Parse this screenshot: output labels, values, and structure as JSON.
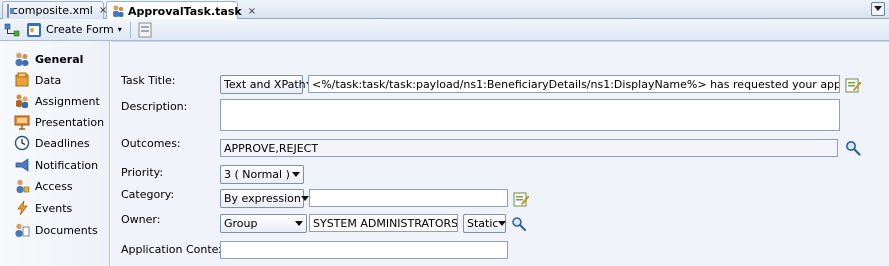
{
  "tabs": [
    {
      "label": "composite.xml",
      "close": "×"
    },
    {
      "label": "ApprovalTask.task",
      "close": "×"
    }
  ],
  "toolbar": {
    "create_form_label": "Create Form",
    "create_form_arrow": "▾"
  },
  "nav": {
    "items": [
      {
        "label": "General",
        "icon": "users-icon"
      },
      {
        "label": "Data",
        "icon": "data-icon"
      },
      {
        "label": "Assignment",
        "icon": "assignment-icon"
      },
      {
        "label": "Presentation",
        "icon": "presentation-icon"
      },
      {
        "label": "Deadlines",
        "icon": "clock-icon"
      },
      {
        "label": "Notification",
        "icon": "megaphone-icon"
      },
      {
        "label": "Access",
        "icon": "access-icon"
      },
      {
        "label": "Events",
        "icon": "lightning-icon"
      },
      {
        "label": "Documents",
        "icon": "documents-icon"
      }
    ]
  },
  "form": {
    "task_title": {
      "label": "Task Title:",
      "mode": "Text and XPath",
      "value": "<%/task:task/task:payload/ns1:BeneficiaryDetails/ns1:DisplayName%> has requested your approval"
    },
    "description": {
      "label": "Description:",
      "value": ""
    },
    "outcomes": {
      "label": "Outcomes:",
      "value": "APPROVE,REJECT"
    },
    "priority": {
      "label": "Priority:",
      "value": "3  ( Normal )"
    },
    "category": {
      "label": "Category:",
      "mode": "By expression",
      "value": ""
    },
    "owner": {
      "label": "Owner:",
      "type": "Group",
      "value": "SYSTEM ADMINISTRATORS",
      "static": "Static"
    },
    "application_context": {
      "label": "Application Context:",
      "value": ""
    }
  },
  "colors": {
    "accent": "#5f86c4",
    "border": "#8ea0b6",
    "panel": "#f0f4fa"
  }
}
